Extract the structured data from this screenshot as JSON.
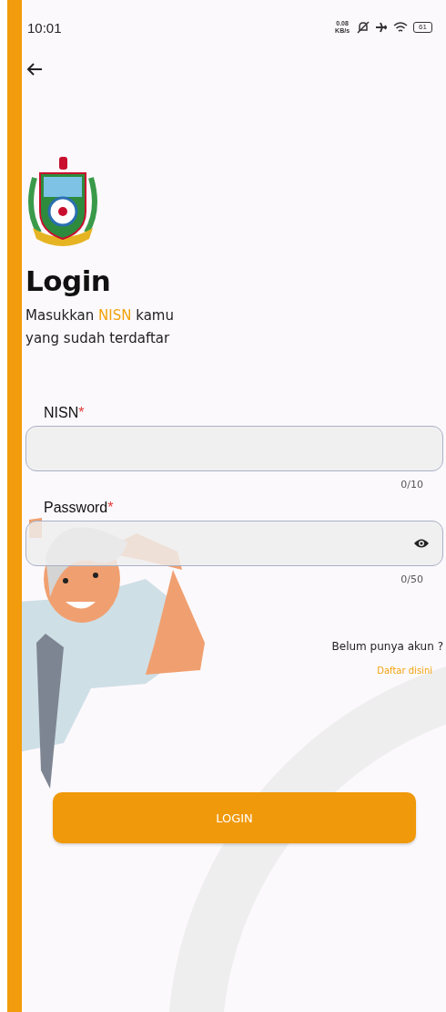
{
  "status_bar": {
    "time": "10:01",
    "network_speed": "0.08 KB/s",
    "battery": "61"
  },
  "header": {
    "title": "Login",
    "subtitle": [
      {
        "text": "Masukkan ",
        "highlight": false
      },
      {
        "text": "NISN",
        "highlight": true
      },
      {
        "text": " kamu yang sudah terdaftar",
        "highlight": false
      }
    ]
  },
  "fields": [
    {
      "kind": "text",
      "label": "NISN",
      "required_mark": "*",
      "counter": "0/10"
    },
    {
      "kind": "password",
      "label": "Password",
      "required_mark": "*",
      "counter": "0/50"
    }
  ],
  "register": {
    "prompt": "Belum punya akun ?",
    "link": "Daftar disini"
  },
  "login_button": "LOGIN"
}
